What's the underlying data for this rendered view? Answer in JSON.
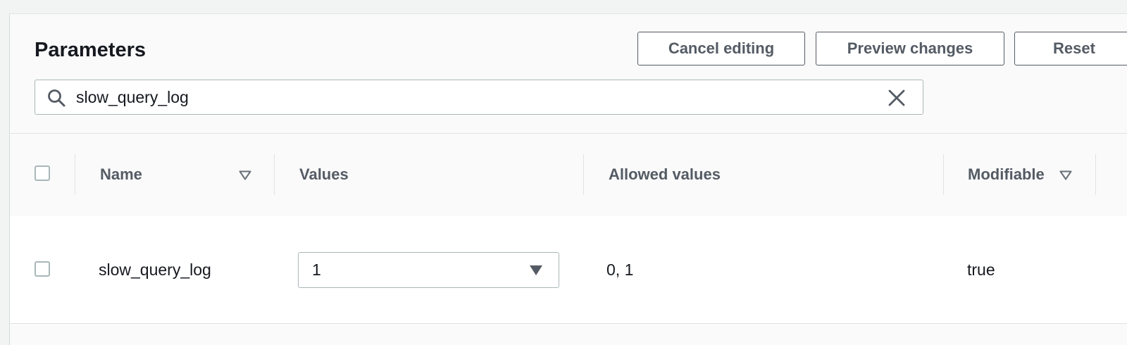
{
  "panel": {
    "title": "Parameters",
    "actions": {
      "cancel_label": "Cancel editing",
      "preview_label": "Preview changes",
      "reset_label": "Reset"
    },
    "search": {
      "value": "slow_query_log",
      "search_icon": "search-icon",
      "clear_icon": "close-icon"
    }
  },
  "table": {
    "columns": {
      "name": "Name",
      "values": "Values",
      "allowed_values": "Allowed values",
      "modifiable": "Modifiable"
    },
    "rows": [
      {
        "name": "slow_query_log",
        "value": "1",
        "allowed_values": "0, 1",
        "modifiable": "true"
      }
    ]
  },
  "colors": {
    "text": "#16191f",
    "muted_text": "#545b64",
    "border": "#aab7b8",
    "panel_bg": "#fafafa"
  }
}
